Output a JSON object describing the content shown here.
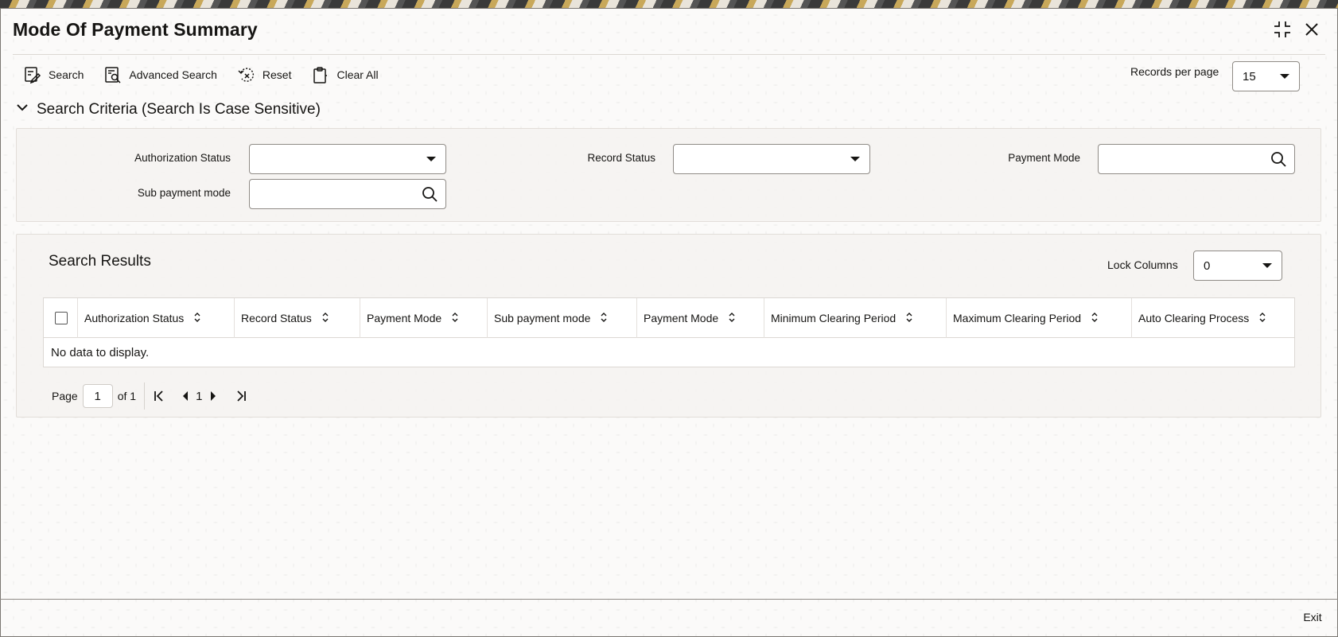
{
  "window": {
    "title": "Mode Of Payment Summary",
    "maximize_icon": "collapse-arrows-icon",
    "close_icon": "close-icon"
  },
  "toolbar": {
    "search_label": "Search",
    "advanced_search_label": "Advanced Search",
    "reset_label": "Reset",
    "clear_all_label": "Clear All"
  },
  "records_per_page": {
    "label": "Records per page",
    "value": "15"
  },
  "search_criteria": {
    "heading": "Search Criteria (Search Is Case Sensitive)",
    "fields": {
      "authorization_status": {
        "label": "Authorization Status",
        "value": ""
      },
      "record_status": {
        "label": "Record Status",
        "value": ""
      },
      "payment_mode": {
        "label": "Payment Mode",
        "value": ""
      },
      "sub_payment_mode": {
        "label": "Sub payment mode",
        "value": ""
      }
    }
  },
  "results": {
    "title": "Search Results",
    "lock_columns": {
      "label": "Lock Columns",
      "value": "0"
    },
    "columns": [
      "Authorization Status",
      "Record Status",
      "Payment Mode",
      "Sub payment mode",
      "Payment Mode",
      "Minimum Clearing Period",
      "Maximum Clearing Period",
      "Auto Clearing Process"
    ],
    "empty_message": "No data to display."
  },
  "pagination": {
    "page_label": "Page",
    "current_page": "1",
    "of_label": "of 1",
    "page_number": "1"
  },
  "footer": {
    "exit_label": "Exit"
  }
}
